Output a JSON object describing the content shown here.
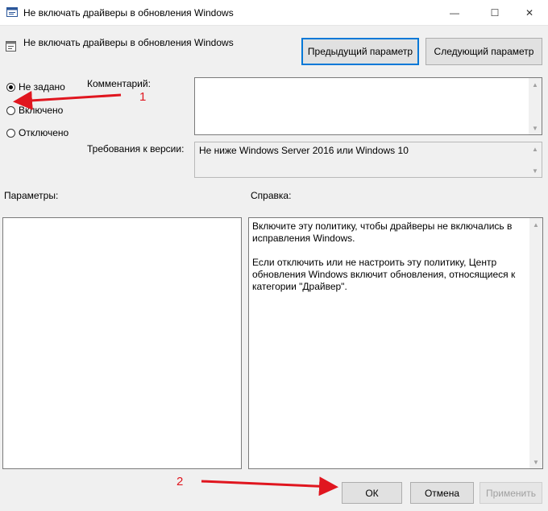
{
  "window": {
    "title": "Не включать драйверы в обновления Windows",
    "controls": {
      "minimize": "—",
      "maximize": "☐",
      "close": "✕"
    }
  },
  "header": {
    "policy_name": "Не включать драйверы в обновления Windows",
    "prev_button": "Предыдущий параметр",
    "next_button": "Следующий параметр"
  },
  "state": {
    "options": [
      "Не задано",
      "Включено",
      "Отключено"
    ],
    "selected": "Не задано"
  },
  "comment": {
    "label": "Комментарий:",
    "value": ""
  },
  "requirements": {
    "label": "Требования к версии:",
    "value": "Не ниже Windows Server 2016 или Windows 10"
  },
  "params": {
    "label": "Параметры:"
  },
  "help": {
    "label": "Справка:",
    "paragraphs": [
      "Включите эту политику, чтобы драйверы не включались в исправления Windows.",
      "Если отключить или не настроить эту политику, Центр обновления Windows включит обновления, относящиеся к категории \"Драйвер\"."
    ]
  },
  "footer": {
    "ok": "ОК",
    "cancel": "Отмена",
    "apply": "Применить"
  },
  "annotations": {
    "marker1": "1",
    "marker2": "2"
  },
  "colors": {
    "annotation": "#e0161f",
    "focus": "#0078d7"
  }
}
